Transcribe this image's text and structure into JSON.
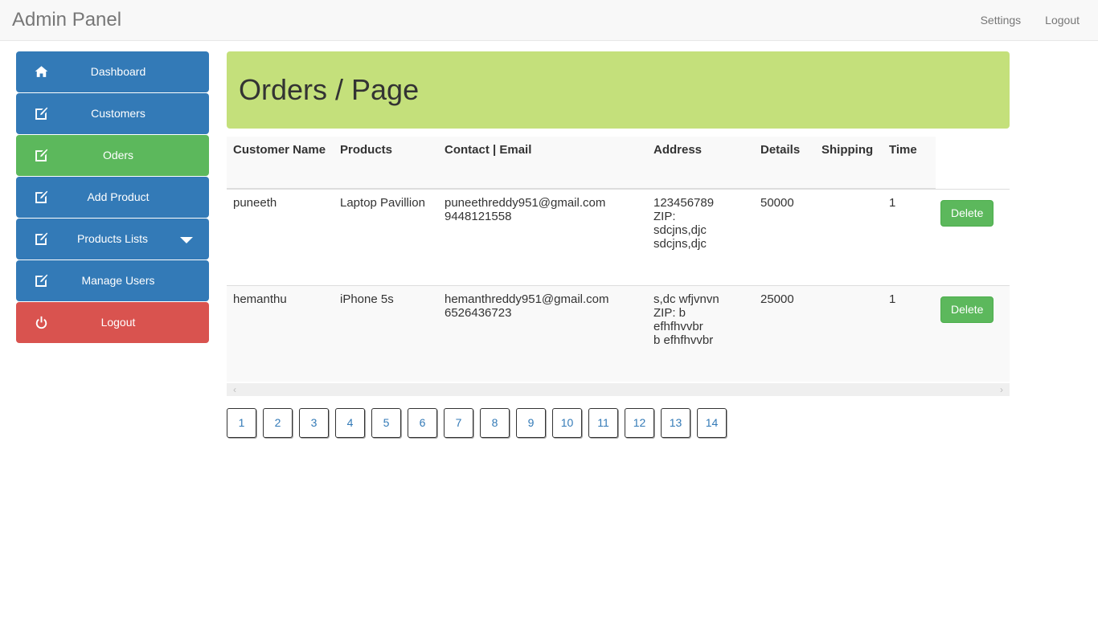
{
  "navbar": {
    "brand": "Admin Panel",
    "links": [
      {
        "label": "Settings",
        "name": "nav-settings"
      },
      {
        "label": "Logout",
        "name": "nav-logout"
      }
    ]
  },
  "sidebar": {
    "items": [
      {
        "label": "Dashboard",
        "icon": "home-icon",
        "color": "blue",
        "caret": false
      },
      {
        "label": "Customers",
        "icon": "edit-square-icon",
        "color": "blue",
        "caret": false
      },
      {
        "label": "Oders",
        "icon": "edit-square-icon",
        "color": "green",
        "caret": false
      },
      {
        "label": "Add Product",
        "icon": "edit-square-icon",
        "color": "blue",
        "caret": false
      },
      {
        "label": "Products Lists",
        "icon": "edit-square-icon",
        "color": "blue",
        "caret": true
      },
      {
        "label": "Manage Users",
        "icon": "edit-square-icon",
        "color": "blue",
        "caret": false
      },
      {
        "label": "Logout",
        "icon": "power-icon",
        "color": "red",
        "caret": false
      }
    ]
  },
  "banner": {
    "title": "Orders / Page",
    "bg_color": "#c4e07b"
  },
  "table": {
    "headers": [
      "Customer Name",
      "Products",
      "Contact | Email",
      "Address",
      "Details",
      "Shipping",
      "Time",
      ""
    ],
    "rows": [
      {
        "customer_name": "puneeth",
        "products": "Laptop Pavillion",
        "contact_email": "puneethreddy951@gmail.com",
        "contact_phone": "9448121558",
        "address_lines": [
          "123456789",
          "ZIP:",
          "sdcjns,djc",
          "sdcjns,djc"
        ],
        "details": "50000",
        "shipping": "",
        "time": "1",
        "action_label": "Delete"
      },
      {
        "customer_name": "hemanthu",
        "products": "iPhone 5s",
        "contact_email": "hemanthreddy951@gmail.com",
        "contact_phone": "6526436723",
        "address_lines": [
          "s,dc wfjvnvn",
          "ZIP: b",
          "efhfhvvbr",
          "b efhfhvvbr"
        ],
        "details": "25000",
        "shipping": "",
        "time": "1",
        "action_label": "Delete"
      }
    ]
  },
  "scrollbar": {
    "left_arrow": "‹",
    "right_arrow": "›"
  },
  "pagination": {
    "pages": [
      "1",
      "2",
      "3",
      "4",
      "5",
      "6",
      "7",
      "8",
      "9",
      "10",
      "11",
      "12",
      "13",
      "14"
    ]
  },
  "colors": {
    "primary_blue": "#337ab7",
    "success_green": "#5cb85c",
    "danger_red": "#d9534f",
    "banner_green": "#c4e07b"
  }
}
